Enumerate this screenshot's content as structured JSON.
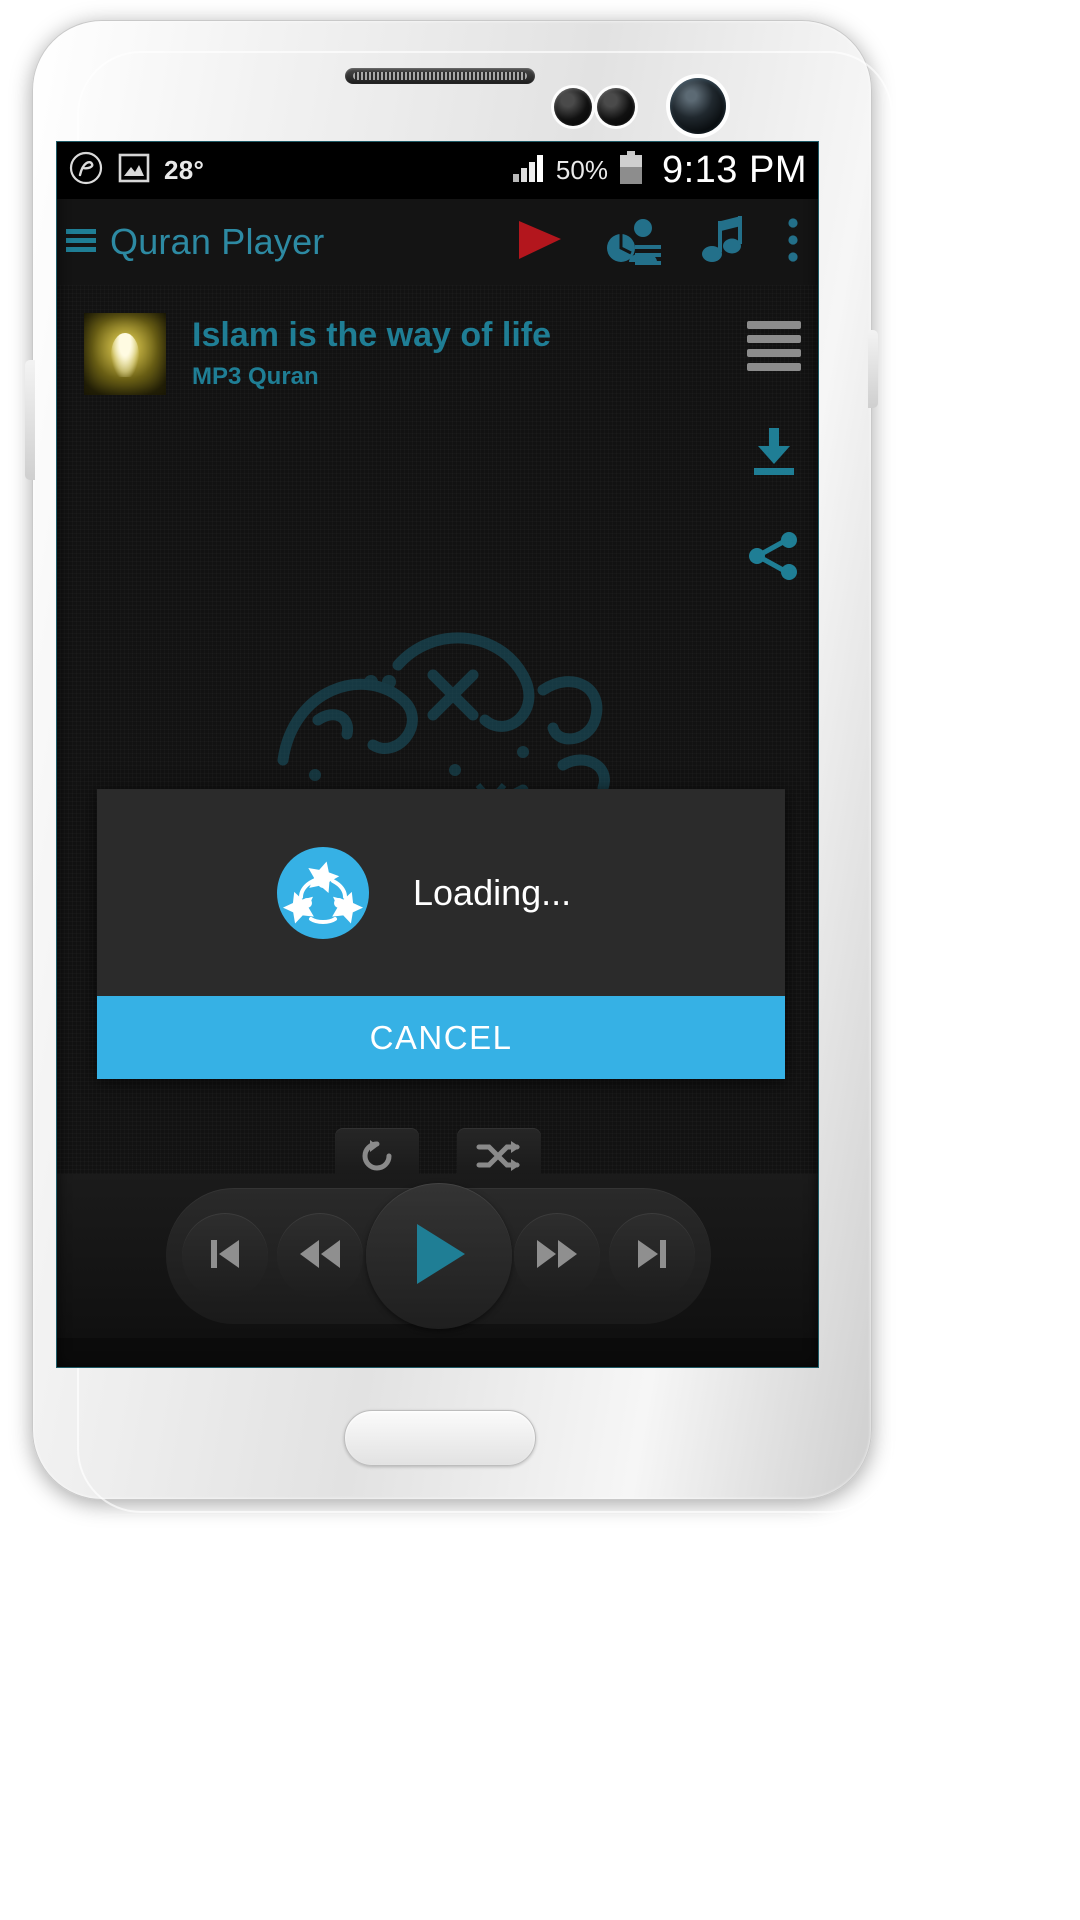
{
  "status_bar": {
    "app_badge_icon": "circle-logo-icon",
    "gallery_icon": "image-icon",
    "temperature": "28°",
    "signal_icon": "signal-bars-icon",
    "battery_percent": "50%",
    "battery_icon": "battery-icon",
    "time": "9:13 PM"
  },
  "action_bar": {
    "menu_icon": "hamburger-menu-icon",
    "title": "Quran Player",
    "icons": [
      {
        "name": "play-video-icon",
        "color": "#b3161d"
      },
      {
        "name": "reciter-list-icon",
        "color": "#23708a"
      },
      {
        "name": "music-note-icon",
        "color": "#23708a"
      },
      {
        "name": "overflow-menu-icon",
        "color": "#23708a"
      }
    ]
  },
  "track": {
    "title": "Islam is the way of life",
    "subtitle": "MP3 Quran",
    "album_art_icon": "album-art-thumbnail"
  },
  "right_rail": [
    {
      "name": "playlist-icon",
      "label": "playlist"
    },
    {
      "name": "download-icon",
      "label": "download"
    },
    {
      "name": "share-icon",
      "label": "share"
    }
  ],
  "background": {
    "watermark_icon": "arabic-calligraphy-watermark"
  },
  "dialog": {
    "spinner_icon": "loading-spinner-stars-icon",
    "message": "Loading...",
    "cancel_label": "CANCEL",
    "accent_color": "#36b1e5",
    "surface_color": "#2b2b2b"
  },
  "modes": [
    {
      "name": "repeat-button",
      "icon": "repeat-icon"
    },
    {
      "name": "shuffle-button",
      "icon": "shuffle-icon"
    }
  ],
  "seek": {
    "position_percent": 0
  },
  "transport": [
    {
      "name": "previous-track-button",
      "icon": "skip-previous-icon"
    },
    {
      "name": "rewind-button",
      "icon": "rewind-icon"
    },
    {
      "name": "play-button",
      "icon": "play-icon"
    },
    {
      "name": "fast-forward-button",
      "icon": "fast-forward-icon"
    },
    {
      "name": "next-track-button",
      "icon": "skip-next-icon"
    }
  ],
  "colors": {
    "teal": "#1f7e95",
    "accent_blue": "#36b1e5",
    "red": "#b3161d",
    "screen_bg": "#121212"
  }
}
